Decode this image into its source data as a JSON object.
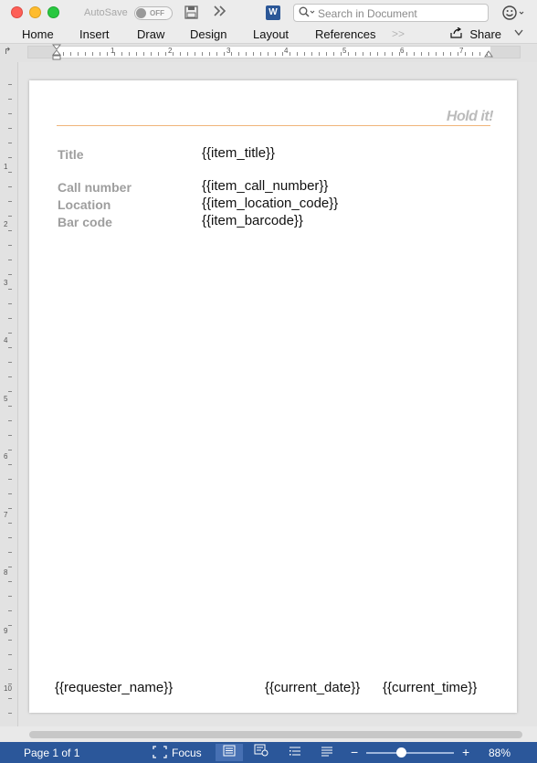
{
  "toolbar": {
    "autosave_label": "AutoSave",
    "autosave_state": "OFF",
    "save_icon": "save-icon",
    "more_icon": "double-chevron-icon",
    "word_icon_letter": "W",
    "search_placeholder": "Search in Document",
    "feedback_icon": "smiley-icon"
  },
  "ribbon": {
    "tabs": [
      "Home",
      "Insert",
      "Draw",
      "Design",
      "Layout",
      "References"
    ],
    "more_tabs_glyph": ">>",
    "share_label": "Share"
  },
  "ruler": {
    "numbers": [
      "1",
      "2",
      "3",
      "4",
      "5",
      "6",
      "7"
    ],
    "vertical_numbers": [
      "1",
      "2",
      "3",
      "4",
      "5",
      "6",
      "7",
      "8",
      "9",
      "10"
    ]
  },
  "document": {
    "brand": "Hold it!",
    "fields": [
      {
        "label": "Title",
        "value": "{{item_title}}"
      },
      {
        "label": "Call number",
        "value": "{{item_call_number}}"
      },
      {
        "label": "Location",
        "value": "{{item_location_code}}"
      },
      {
        "label": "Bar code",
        "value": "{{item_barcode}}"
      }
    ],
    "footer": {
      "requester": "{{requester_name}}",
      "date": "{{current_date}}",
      "time": "{{current_time}}"
    },
    "accent_color": "#f0b47a"
  },
  "statusbar": {
    "page_info": "Page 1 of 1",
    "focus_label": "Focus",
    "zoom_minus": "−",
    "zoom_plus": "+",
    "zoom_level": "88%",
    "zoom_fraction": 0.4,
    "color": "#2b579a"
  }
}
